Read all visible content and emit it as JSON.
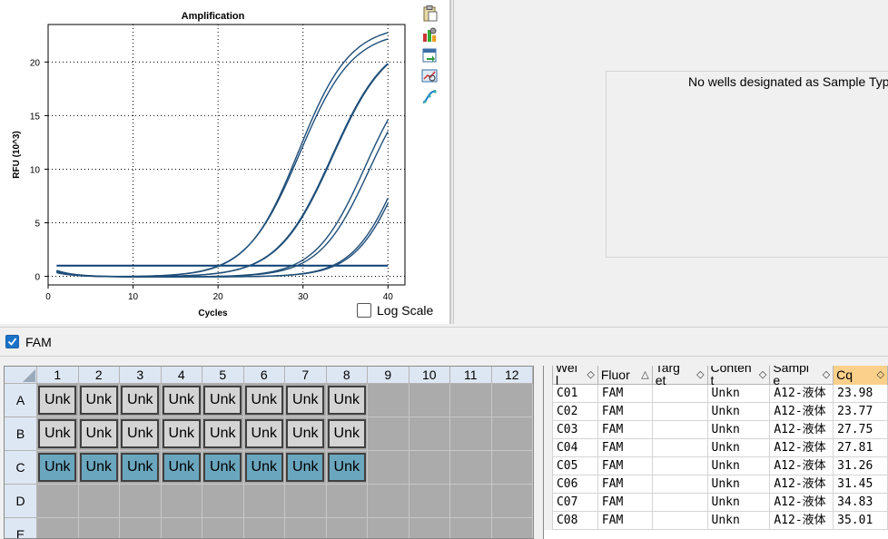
{
  "chart_data": {
    "type": "line",
    "title": "Amplification",
    "xlabel": "Cycles",
    "ylabel": "RFU (10^3)",
    "xlim": [
      0,
      42
    ],
    "ylim": [
      -0.8,
      23.5
    ],
    "xticks": [
      0,
      10,
      20,
      30,
      40
    ],
    "yticks": [
      0,
      5,
      10,
      15,
      20
    ],
    "grid": true,
    "threshold": 1.0,
    "cycle_range": [
      1,
      40
    ],
    "series": [
      {
        "well": "C01",
        "values": {
          "plateau": 23.5,
          "midpoint": 29.5,
          "slope": 0.33,
          "start": 0.5
        }
      },
      {
        "well": "C02",
        "values": {
          "plateau": 23.0,
          "midpoint": 29.6,
          "slope": 0.32,
          "start": 0.6
        }
      },
      {
        "well": "C03",
        "values": {
          "plateau": 22.5,
          "midpoint": 33.4,
          "slope": 0.31,
          "start": 0.4
        }
      },
      {
        "well": "C04",
        "values": {
          "plateau": 22.5,
          "midpoint": 33.5,
          "slope": 0.31,
          "start": 0.5
        }
      },
      {
        "well": "C05",
        "values": {
          "plateau": 20.5,
          "midpoint": 37.3,
          "slope": 0.34,
          "start": 0.5
        }
      },
      {
        "well": "C06",
        "values": {
          "plateau": 20.0,
          "midpoint": 37.8,
          "slope": 0.34,
          "start": 0.6
        }
      },
      {
        "well": "C07",
        "values": {
          "plateau": 20.0,
          "midpoint": 41.5,
          "slope": 0.36,
          "start": 0.4
        }
      },
      {
        "well": "C08",
        "values": {
          "plateau": 20.0,
          "midpoint": 41.8,
          "slope": 0.36,
          "start": 0.5
        }
      }
    ]
  },
  "chart_colors": {
    "line": "#1f4e79",
    "threshold": "#0c3f74",
    "grid": "#000000"
  },
  "log_scale_label": "Log Scale",
  "toolbar_icons": [
    "clipboard-icon",
    "chart-settings-icon",
    "export-icon",
    "zoom-chart-icon",
    "curve-fit-icon"
  ],
  "message": "No wells designated as Sample Typ",
  "fluor": {
    "label": "FAM",
    "checked": true
  },
  "plate": {
    "columns": [
      "1",
      "2",
      "3",
      "4",
      "5",
      "6",
      "7",
      "8",
      "9",
      "10",
      "11",
      "12"
    ],
    "rows": [
      {
        "label": "A",
        "wells": [
          "Unk",
          "Unk",
          "Unk",
          "Unk",
          "Unk",
          "Unk",
          "Unk",
          "Unk"
        ],
        "style": "grey"
      },
      {
        "label": "B",
        "wells": [
          "Unk",
          "Unk",
          "Unk",
          "Unk",
          "Unk",
          "Unk",
          "Unk",
          "Unk"
        ],
        "style": "grey"
      },
      {
        "label": "C",
        "wells": [
          "Unk",
          "Unk",
          "Unk",
          "Unk",
          "Unk",
          "Unk",
          "Unk",
          "Unk"
        ],
        "style": "teal"
      },
      {
        "label": "D",
        "wells": [],
        "style": "empty"
      },
      {
        "label": "E",
        "wells": [],
        "style": "empty"
      }
    ],
    "colors": {
      "grey": "#d4d4d4",
      "teal": "#6aa6bd"
    }
  },
  "table": {
    "headers": [
      "Wel\nl",
      "Fluor",
      "Targ\net",
      "Conten\nt",
      "Sampl\ne",
      "Cq"
    ],
    "active_header": 5,
    "rows": [
      [
        "C01",
        "FAM",
        "",
        "Unkn",
        "A12-液体",
        "23.98"
      ],
      [
        "C02",
        "FAM",
        "",
        "Unkn",
        "A12-液体",
        "23.77"
      ],
      [
        "C03",
        "FAM",
        "",
        "Unkn",
        "A12-液体",
        "27.75"
      ],
      [
        "C04",
        "FAM",
        "",
        "Unkn",
        "A12-液体",
        "27.81"
      ],
      [
        "C05",
        "FAM",
        "",
        "Unkn",
        "A12-液体",
        "31.26"
      ],
      [
        "C06",
        "FAM",
        "",
        "Unkn",
        "A12-液体",
        "31.45"
      ],
      [
        "C07",
        "FAM",
        "",
        "Unkn",
        "A12-液体",
        "34.83"
      ],
      [
        "C08",
        "FAM",
        "",
        "Unkn",
        "A12-液体",
        "35.01"
      ]
    ]
  }
}
